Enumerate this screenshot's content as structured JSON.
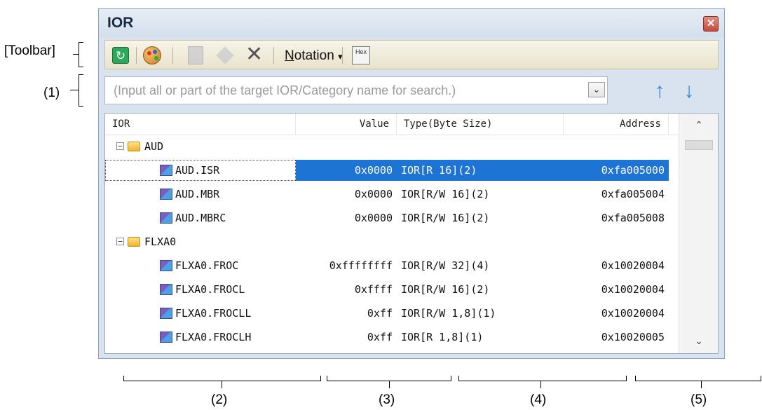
{
  "annotations": {
    "toolbar": "[Toolbar]",
    "search": "(1)",
    "col_ior": "(2)",
    "col_value": "(3)",
    "col_type": "(4)",
    "col_address": "(5)"
  },
  "window": {
    "title": "IOR",
    "close_glyph": "✕"
  },
  "toolbar": {
    "refresh_icon": "refresh-icon",
    "palette_icon": "color-palette-icon",
    "register_icon": "register-icon",
    "eraser_icon": "eraser-icon",
    "delete_glyph": "✕",
    "notation_label_prefix": "N",
    "notation_label_rest": "otation",
    "notation_arrow": "▾",
    "hex_label": "Hex"
  },
  "search": {
    "placeholder": "(Input all or part of the target IOR/Category name for search.)",
    "dropdown_glyph": "⌄",
    "up_glyph": "↑",
    "down_glyph": "↓"
  },
  "list": {
    "headers": {
      "ior": "IOR",
      "value": "Value",
      "type": "Type(Byte Size)",
      "address": "Address"
    },
    "groups": [
      {
        "name": "AUD",
        "expander": "−",
        "items": [
          {
            "name": "AUD.ISR",
            "value": "0x0000",
            "type": "IOR[R 16](2)",
            "address": "0xfa005000",
            "selected": true
          },
          {
            "name": "AUD.MBR",
            "value": "0x0000",
            "type": "IOR[R/W 16](2)",
            "address": "0xfa005004"
          },
          {
            "name": "AUD.MBRC",
            "value": "0x0000",
            "type": "IOR[R/W 16](2)",
            "address": "0xfa005008"
          }
        ]
      },
      {
        "name": "FLXA0",
        "expander": "−",
        "items": [
          {
            "name": "FLXA0.FROC",
            "value": "0xffffffff",
            "type": "IOR[R/W 32](4)",
            "address": "0x10020004"
          },
          {
            "name": "FLXA0.FROCL",
            "value": "0xffff",
            "type": "IOR[R/W 16](2)",
            "address": "0x10020004"
          },
          {
            "name": "FLXA0.FROCLL",
            "value": "0xff",
            "type": "IOR[R/W 1,8](1)",
            "address": "0x10020004"
          },
          {
            "name": "FLXA0.FROCLH",
            "value": "0xff",
            "type": "IOR[R 1,8](1)",
            "address": "0x10020005"
          }
        ]
      }
    ],
    "scroll": {
      "up_glyph": "⌃",
      "down_glyph": "⌄"
    }
  }
}
